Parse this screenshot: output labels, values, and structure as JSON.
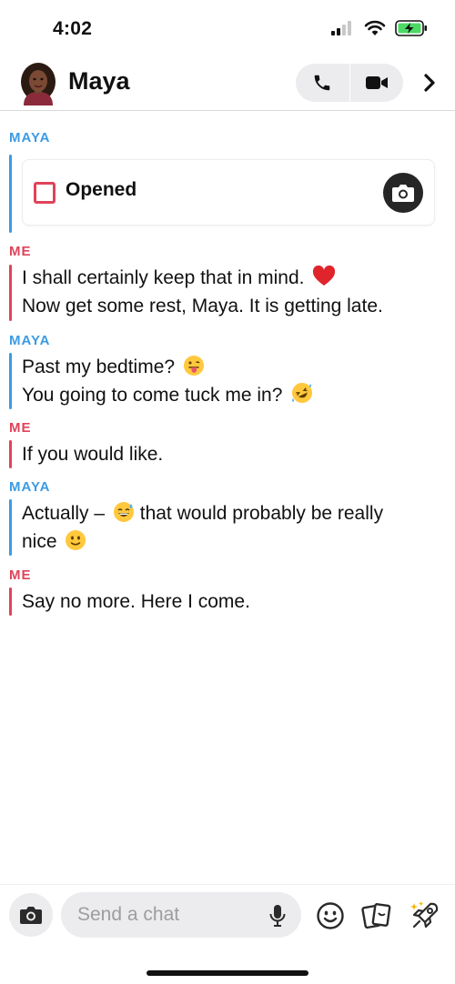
{
  "status_bar": {
    "time": "4:02",
    "icons": [
      "cellular-signal-icon",
      "wifi-icon",
      "battery-charging-icon"
    ],
    "battery_color": "#4cd964"
  },
  "header": {
    "contact_name": "Maya",
    "buttons": [
      "phone-call-icon",
      "video-call-icon",
      "chevron-right-icon"
    ]
  },
  "colors": {
    "maya": "#3a9be4",
    "me": "#e0435a"
  },
  "chat": {
    "sections": [
      {
        "sender": "MAYA",
        "snap": {
          "status": "Opened"
        }
      },
      {
        "sender": "ME",
        "messages": [
          {
            "text": "I shall certainly keep that in mind.",
            "emoji": "red-heart-emoji"
          },
          {
            "text": "Now get some rest, Maya. It is getting late."
          }
        ]
      },
      {
        "sender": "MAYA",
        "messages": [
          {
            "text": "Past my bedtime?",
            "emoji": "tongue-out-emoji"
          },
          {
            "text": "You going to come tuck me in?",
            "emoji": "rolling-laughing-emoji"
          }
        ]
      },
      {
        "sender": "ME",
        "messages": [
          {
            "text": "If you would like."
          }
        ]
      },
      {
        "sender": "MAYA",
        "messages": [
          {
            "text_before": "Actually –",
            "emoji": "sweat-smile-emoji",
            "text_after": "that would probably be really",
            "line2": "nice",
            "emoji2": "slight-smile-emoji"
          }
        ]
      },
      {
        "sender": "ME",
        "messages": [
          {
            "text": "Say no more. Here I come."
          }
        ]
      }
    ]
  },
  "composer": {
    "placeholder": "Send a chat",
    "value": "",
    "tools": [
      "camera-icon",
      "microphone-icon",
      "smiley-icon",
      "stickers-icon",
      "rocket-icon"
    ]
  }
}
